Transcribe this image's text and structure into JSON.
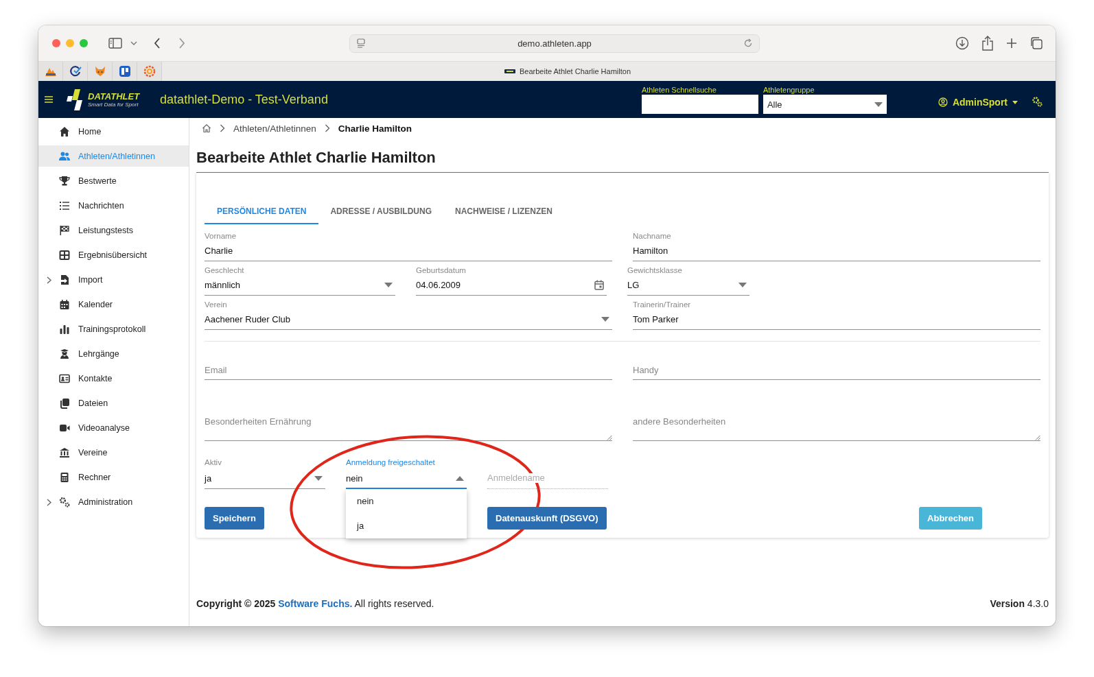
{
  "browser": {
    "url": "demo.athleten.app",
    "tab_title": "Bearbeite Athlet Charlie Hamilton"
  },
  "header": {
    "title": "datathlet-Demo - Test-Verband",
    "logo": "DATATHLET",
    "logo_tagline": "Smart Data for Sport",
    "quick_search": {
      "label": "Athleten Schnellsuche"
    },
    "group": {
      "label": "Athletengruppe",
      "value": "Alle"
    },
    "user": "AdminSport"
  },
  "sidebar": {
    "items": [
      {
        "label": "Home",
        "selected": false,
        "expandable": false
      },
      {
        "label": "Athleten/Athletinnen",
        "selected": true,
        "expandable": false
      },
      {
        "label": "Bestwerte",
        "selected": false,
        "expandable": false
      },
      {
        "label": "Nachrichten",
        "selected": false,
        "expandable": false
      },
      {
        "label": "Leistungstests",
        "selected": false,
        "expandable": false
      },
      {
        "label": "Ergebnisübersicht",
        "selected": false,
        "expandable": false
      },
      {
        "label": "Import",
        "selected": false,
        "expandable": true
      },
      {
        "label": "Kalender",
        "selected": false,
        "expandable": false
      },
      {
        "label": "Trainingsprotokoll",
        "selected": false,
        "expandable": false
      },
      {
        "label": "Lehrgänge",
        "selected": false,
        "expandable": false
      },
      {
        "label": "Kontakte",
        "selected": false,
        "expandable": false
      },
      {
        "label": "Dateien",
        "selected": false,
        "expandable": false
      },
      {
        "label": "Videoanalyse",
        "selected": false,
        "expandable": false
      },
      {
        "label": "Vereine",
        "selected": false,
        "expandable": false
      },
      {
        "label": "Rechner",
        "selected": false,
        "expandable": false
      },
      {
        "label": "Administration",
        "selected": false,
        "expandable": true
      }
    ]
  },
  "breadcrumb": [
    "Athleten/Athletinnen",
    "Charlie Hamilton"
  ],
  "page_title": "Bearbeite Athlet Charlie Hamilton",
  "tabs": [
    {
      "label": "PERSÖNLICHE DATEN",
      "selected": true
    },
    {
      "label": "ADRESSE / AUSBILDUNG",
      "selected": false
    },
    {
      "label": "NACHWEISE / LIZENZEN",
      "selected": false
    }
  ],
  "form": {
    "sections": [
      {
        "rows": [
          [
            {
              "kind": "text",
              "label": "Vorname",
              "value": "Charlie",
              "focused": false,
              "disabled": false
            },
            {
              "kind": "text",
              "label": "Nachname",
              "value": "Hamilton",
              "focused": false,
              "disabled": false
            }
          ],
          [
            {
              "kind": "select",
              "label": "Geschlecht",
              "value": "männlich",
              "open": false,
              "focused": false,
              "disabled": false
            },
            {
              "kind": "date",
              "label": "Geburtsdatum",
              "value": "04.06.2009",
              "focused": false,
              "disabled": false
            },
            {
              "kind": "select",
              "label": "Gewichtsklasse",
              "value": "LG",
              "open": false,
              "focused": false,
              "disabled": false
            }
          ],
          [
            {
              "kind": "select",
              "label": "Verein",
              "value": "Aachener Ruder Club",
              "open": false,
              "focused": false,
              "disabled": false
            },
            {
              "kind": "text",
              "label": "Trainerin/Trainer",
              "value": "Tom Parker",
              "focused": false,
              "disabled": false
            }
          ]
        ]
      },
      {
        "rows": [
          [
            {
              "kind": "text",
              "label": "Email",
              "focused": false,
              "disabled": false
            },
            {
              "kind": "text",
              "label": "Handy",
              "focused": false,
              "disabled": false
            }
          ],
          [
            {
              "kind": "textarea",
              "label": "Besonderheiten Ernährung",
              "focused": false,
              "disabled": false
            },
            {
              "kind": "textarea",
              "label": "andere Besonderheiten",
              "focused": false,
              "disabled": false
            }
          ],
          [
            {
              "kind": "select",
              "label": "Aktiv",
              "value": "ja",
              "open": false,
              "focused": false,
              "disabled": false
            },
            {
              "kind": "select",
              "label": "Anmeldung freigeschaltet",
              "value": "nein",
              "open": true,
              "focused": true,
              "disabled": false,
              "options": [
                "nein",
                "ja"
              ]
            },
            {
              "kind": "text",
              "label": "Anmeldename",
              "focused": false,
              "disabled": true
            }
          ]
        ]
      }
    ],
    "buttons": [
      {
        "label": "Speichern",
        "kind": "primary"
      },
      {
        "label": "Datenauskunft (DSGVO)",
        "kind": "primary"
      },
      {
        "label": "Abbrechen",
        "kind": "info"
      }
    ]
  },
  "footer": {
    "copyright": "Copyright © 2025",
    "link": "Software Fuchs.",
    "rest": "All rights reserved.",
    "version": "**Version** 4.3.0"
  },
  "annotations": [
    {
      "kind": "ellipse"
    }
  ]
}
